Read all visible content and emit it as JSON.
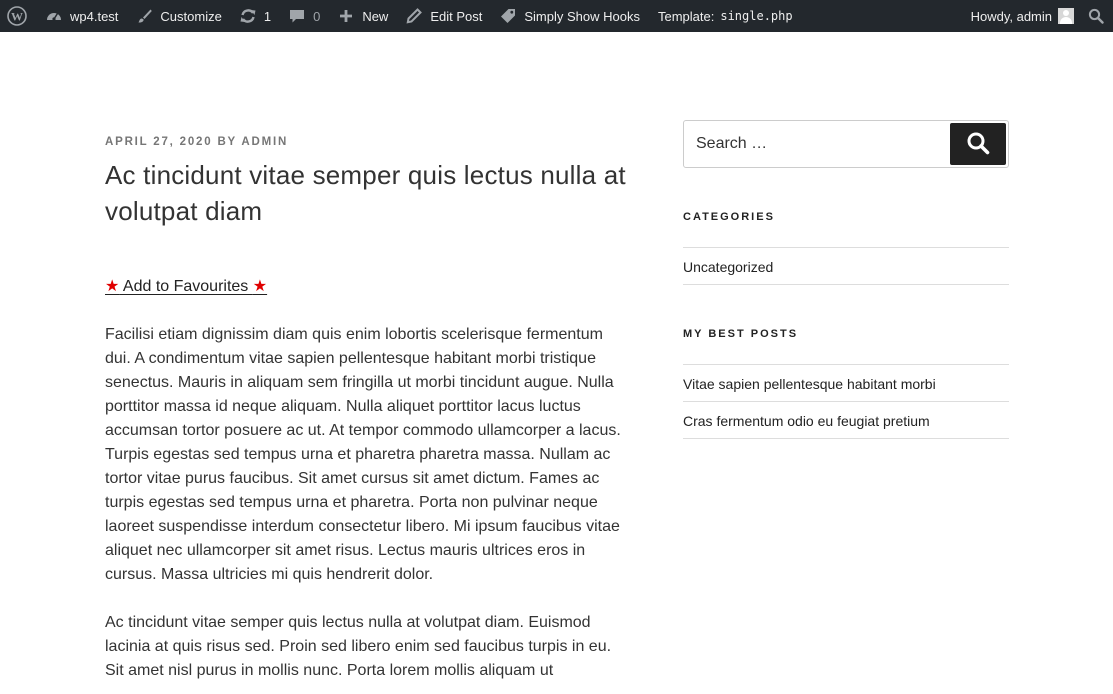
{
  "adminbar": {
    "site_name": "wp4.test",
    "customize": "Customize",
    "updates_count": "1",
    "comments_count": "0",
    "new_label": "New",
    "edit_post": "Edit Post",
    "hooks": "Simply Show Hooks",
    "template_label": "Template:",
    "template_file": "single.php",
    "howdy": "Howdy, admin"
  },
  "post": {
    "date": "April 27, 2020",
    "by": "by",
    "author": "admin",
    "title": "Ac tincidunt vitae semper quis lectus nulla at volutpat diam",
    "fav_star_left": "★",
    "fav_label": " Add to Favourites ",
    "fav_star_right": "★",
    "paragraphs": [
      "Facilisi etiam dignissim diam quis enim lobortis scelerisque fermentum dui. A condimentum vitae sapien pellentesque habitant morbi tristique senectus. Mauris in aliquam sem fringilla ut morbi tincidunt augue. Nulla porttitor massa id neque aliquam. Nulla aliquet porttitor lacus luctus accumsan tortor posuere ac ut. At tempor commodo ullamcorper a lacus. Turpis egestas sed tempus urna et pharetra pharetra massa. Nullam ac tortor vitae purus faucibus. Sit amet cursus sit amet dictum. Fames ac turpis egestas sed tempus urna et pharetra. Porta non pulvinar neque laoreet suspendisse interdum consectetur libero. Mi ipsum faucibus vitae aliquet nec ullamcorper sit amet risus. Lectus mauris ultrices eros in cursus. Massa ultricies mi quis hendrerit dolor.",
      "Ac tincidunt vitae semper quis lectus nulla at volutpat diam. Euismod lacinia at quis risus sed. Proin sed libero enim sed faucibus turpis in eu. Sit amet nisl purus in mollis nunc. Porta lorem mollis aliquam ut"
    ]
  },
  "sidebar": {
    "search_placeholder": "Search …",
    "categories_title": "Categories",
    "categories": [
      "Uncategorized"
    ],
    "best_posts_title": "My Best Posts",
    "best_posts": [
      "Vitae sapien pellentesque habitant morbi",
      "Cras fermentum odio eu feugiat pretium"
    ]
  },
  "icons": {
    "wordpress": "wordpress-logo-icon",
    "dashboard": "dashboard-icon",
    "customize": "brush-icon",
    "updates": "updates-icon",
    "comments": "comment-icon",
    "new": "plus-icon",
    "edit": "pencil-icon",
    "hooks": "tag-icon",
    "search": "search-icon"
  },
  "colors": {
    "adminbar_bg": "#23282d",
    "star": "#e00000",
    "search_button": "#222222"
  }
}
